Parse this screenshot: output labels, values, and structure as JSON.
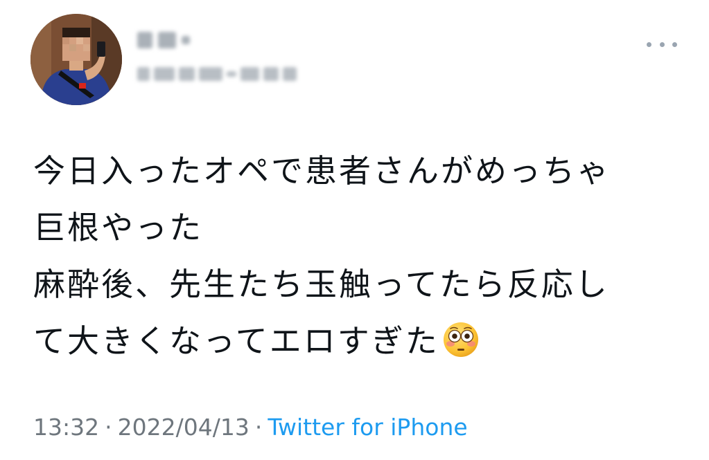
{
  "tweet": {
    "author": {
      "avatar_icon": "profile-avatar",
      "name_blurred": true,
      "handle_blurred": true
    },
    "more_icon": "more-horizontal-icon",
    "text_lines": [
      "今日入ったオペで患者さんがめっちゃ",
      "巨根やった",
      "麻酔後、先生たち玉触ってたら反応し",
      "て大きくなってエロすぎた"
    ],
    "emoji": "flushed-face-emoji",
    "meta": {
      "time": "13:32",
      "separator": "·",
      "date": "2022/04/13",
      "source": "Twitter for iPhone"
    },
    "colors": {
      "text": "#0f1419",
      "meta": "#6e767d",
      "link": "#1d9bf0"
    }
  }
}
